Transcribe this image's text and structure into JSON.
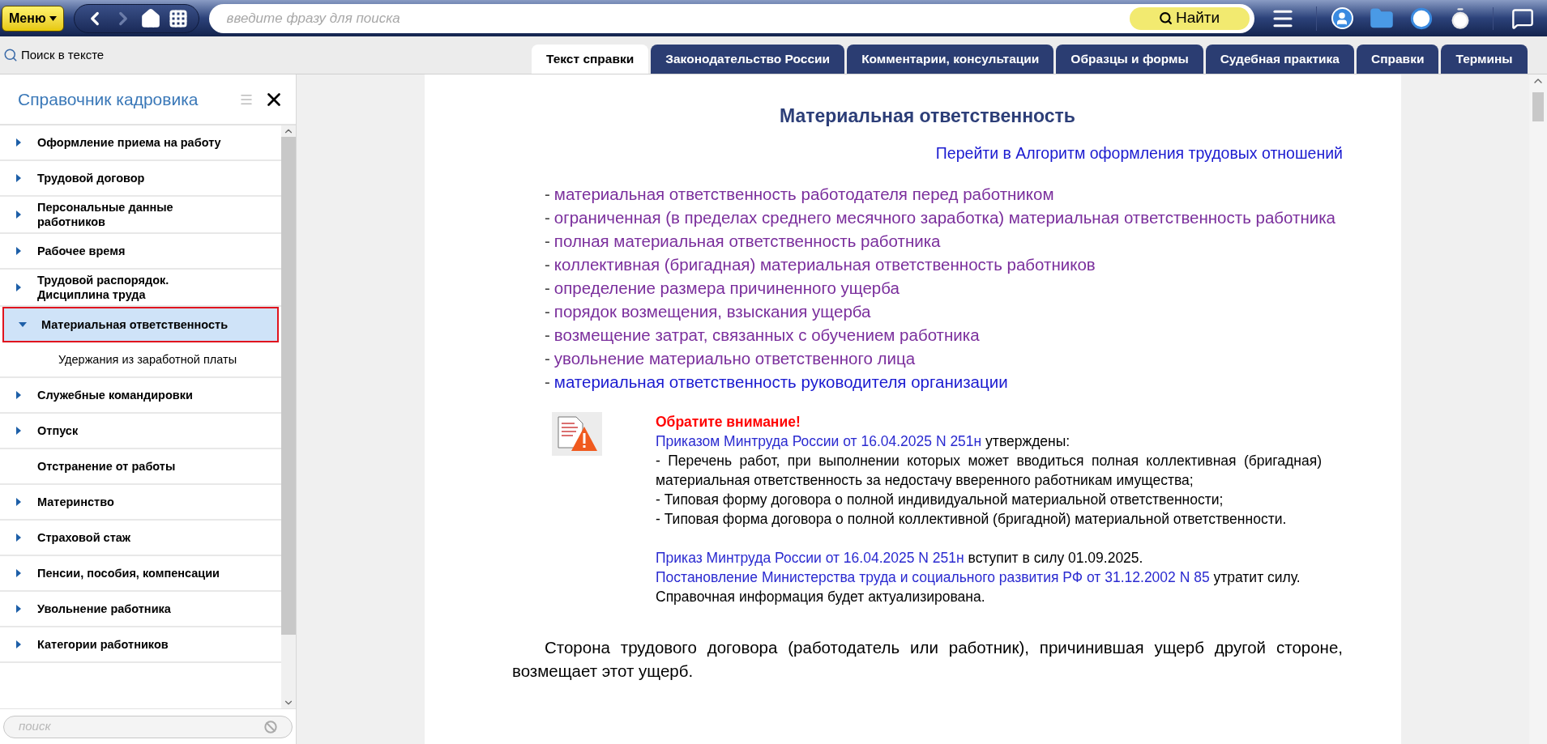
{
  "toolbar": {
    "menu_button": "Меню",
    "search": {
      "placeholder": "введите фразу для поиска"
    },
    "find_button": "Найти"
  },
  "text_search_link": "Поиск в тексте",
  "tabs": [
    {
      "label": "Текст справки",
      "selected": true
    },
    {
      "label": "Законодательство России",
      "selected": false
    },
    {
      "label": "Комментарии, консультации",
      "selected": false
    },
    {
      "label": "Образцы и формы",
      "selected": false
    },
    {
      "label": "Судебная практика",
      "selected": false
    },
    {
      "label": "Справки",
      "selected": false
    },
    {
      "label": "Термины",
      "selected": false
    }
  ],
  "sidebar": {
    "title": "Справочник кадровика",
    "items": [
      {
        "label": "Оформление приема на работу",
        "kind": "folder",
        "expanded": false,
        "selected": false
      },
      {
        "label": "Трудовой договор",
        "kind": "folder",
        "expanded": false,
        "selected": false
      },
      {
        "label": "Персональные данные работников",
        "kind": "folder",
        "expanded": false,
        "selected": false
      },
      {
        "label": "Рабочее время",
        "kind": "folder",
        "expanded": false,
        "selected": false
      },
      {
        "label": "Трудовой распорядок. Дисциплина труда",
        "kind": "folder",
        "expanded": false,
        "selected": false
      },
      {
        "label": "Материальная ответственность",
        "kind": "folder",
        "expanded": true,
        "selected": true,
        "children": [
          {
            "label": "Удержания из заработной платы",
            "kind": "leaf",
            "selected": false
          }
        ]
      },
      {
        "label": "Служебные командировки",
        "kind": "folder",
        "expanded": false,
        "selected": false
      },
      {
        "label": "Отпуск",
        "kind": "folder",
        "expanded": false,
        "selected": false
      },
      {
        "label": "Отстранение от работы",
        "kind": "leaf",
        "selected": false
      },
      {
        "label": "Материнство",
        "kind": "folder",
        "expanded": false,
        "selected": false
      },
      {
        "label": "Страховой стаж",
        "kind": "folder",
        "expanded": false,
        "selected": false
      },
      {
        "label": "Пенсии, пособия, компенсации",
        "kind": "folder",
        "expanded": false,
        "selected": false
      },
      {
        "label": "Увольнение работника",
        "kind": "folder",
        "expanded": false,
        "selected": false
      },
      {
        "label": "Категории работников",
        "kind": "folder",
        "expanded": false,
        "selected": false
      }
    ],
    "search": {
      "placeholder": "поиск"
    }
  },
  "document": {
    "title": "Материальная ответственность",
    "algorithm_link": "Перейти в Алгоритм оформления трудовых отношений",
    "links": [
      {
        "bullet": "-",
        "text": "материальная ответственность работодателя перед работником",
        "visited": true
      },
      {
        "bullet": "-",
        "text": "ограниченная (в пределах среднего месячного заработка) материальная ответственность работника",
        "visited": true
      },
      {
        "bullet": "-",
        "text": "полная материальная ответственность работника",
        "visited": true
      },
      {
        "bullet": "-",
        "text": "коллективная (бригадная) материальная ответственность работников",
        "visited": true
      },
      {
        "bullet": "-",
        "text": "определение размера причиненного ущерба",
        "visited": true
      },
      {
        "bullet": "-",
        "text": "порядок возмещения, взыскания ущерба",
        "visited": true
      },
      {
        "bullet": "-",
        "text": "возмещение затрат, связанных с обучением работника",
        "visited": true
      },
      {
        "bullet": "-",
        "text": "увольнение материально ответственного лица",
        "visited": true
      },
      {
        "bullet": "-",
        "text": "материальная ответственность руководителя организации",
        "visited": false
      }
    ],
    "notice": {
      "heading": "Обратите внимание!",
      "blocks": [
        [
          [
            {
              "kind": "link",
              "text": "Приказом Минтруда России от 16.04.2025 N 251н"
            },
            {
              "kind": "plain",
              "text": " утверждены:"
            }
          ],
          [
            {
              "kind": "plain",
              "text": "- Перечень работ, при выполнении которых может вводиться полная коллективная (бригадная) материальная ответственность за недостачу вверенного работникам имущества;"
            }
          ],
          [
            {
              "kind": "plain",
              "text": "- Типовая форму договора о полной индивидуальной материальной ответственности;"
            }
          ],
          [
            {
              "kind": "plain",
              "text": "- Типовая форма договора о полной коллективной (бригадной) материальной ответственности."
            }
          ]
        ],
        [
          [
            {
              "kind": "link",
              "text": "Приказ Минтруда России от 16.04.2025 N 251н"
            },
            {
              "kind": "plain",
              "text": " вступит в силу 01.09.2025."
            }
          ],
          [
            {
              "kind": "link",
              "text": "Постановление Министерства труда и социального развития РФ от 31.12.2002 N 85"
            },
            {
              "kind": "plain",
              "text": " утратит силу."
            }
          ],
          [
            {
              "kind": "plain",
              "text": "Справочная информация будет актуализирована."
            }
          ]
        ]
      ]
    },
    "body": "Сторона трудового договора (работодатель или работник), причинившая ущерб другой стороне, возмещает этот ущерб."
  }
}
